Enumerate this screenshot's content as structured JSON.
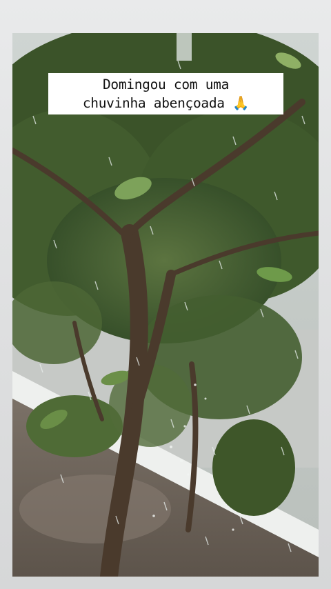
{
  "story": {
    "caption_line_1": "Domingou com uma",
    "caption_line_2": "chuvinha abençoada",
    "caption_emoji": "🙏"
  },
  "photo": {
    "subject": "tree-icon",
    "weather": "rain-icon",
    "colors": {
      "foliage": "#3f5a2c",
      "sky": "#d2d6d4",
      "ground": "#6e645a",
      "trunk": "#4a3a2c"
    }
  }
}
